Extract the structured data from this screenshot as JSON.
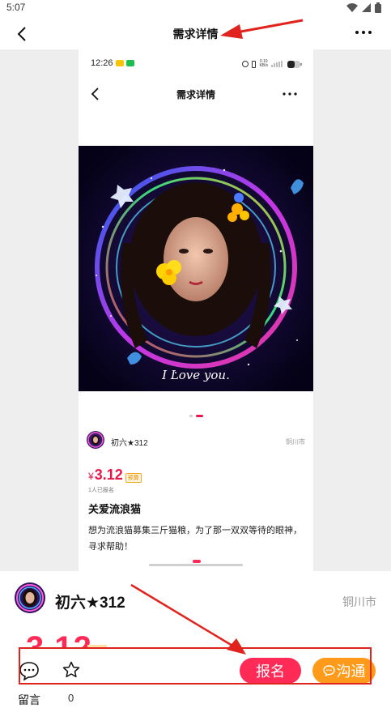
{
  "status_bar": {
    "time": "5:07"
  },
  "nav": {
    "title": "需求详情"
  },
  "embedded": {
    "time": "12:26",
    "network_speed_value": "0.10",
    "network_speed_unit": "KB/s",
    "title": "需求详情",
    "user": {
      "name": "初六★312",
      "city": "铜川市"
    },
    "price": {
      "currency": "¥",
      "amount": "3.12",
      "tag": "预算"
    },
    "signup_count": "1人已报名",
    "post_title": "关爱流浪猫",
    "post_desc": "想为流浪猫募集三斤猫粮，为了那一双双等待的眼神，寻求帮助！",
    "image_caption": "I Love you."
  },
  "user": {
    "name": "初六★312",
    "city": "铜川市"
  },
  "price_peek": "3.12",
  "bottom_bar": {
    "comment_label": "留言",
    "collect_count": "0",
    "signup_label": "报名",
    "chat_label": "沟通"
  },
  "colors": {
    "accent": "#ff2a56",
    "chat": "#ff9a1a",
    "annotation": "#e0231d"
  },
  "icons": [
    "back-arrow-icon",
    "more-dots-icon",
    "comment-icon",
    "star-icon",
    "chat-bubble-icon",
    "wifi-icon",
    "battery-icon"
  ]
}
